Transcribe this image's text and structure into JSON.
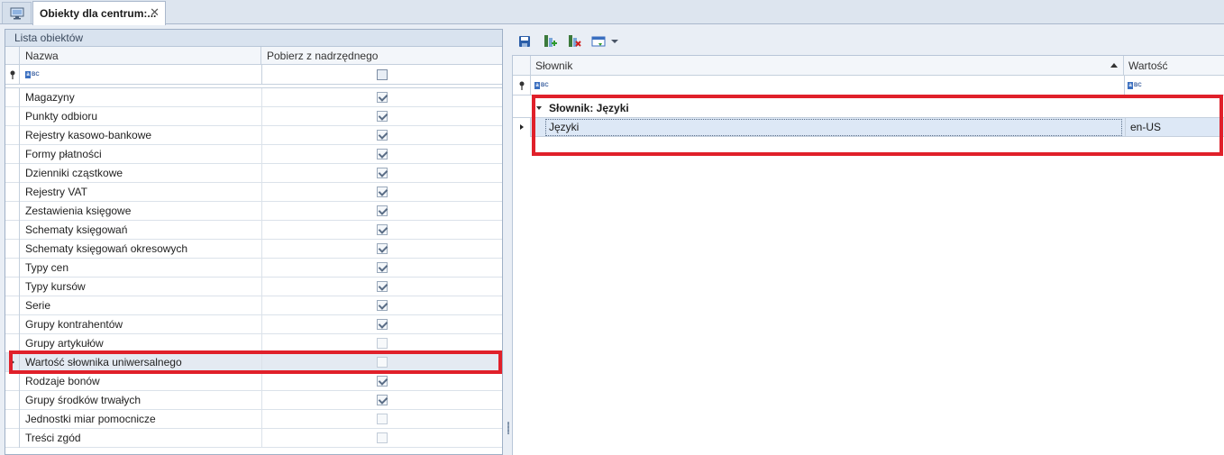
{
  "tabs": {
    "home_icon": "monitor-icon",
    "active_label": "Obiekty dla centrum:...",
    "close_glyph": "✕"
  },
  "left": {
    "panel_title": "Lista obiektów",
    "columns": {
      "name": "Nazwa",
      "inherit": "Pobierz z nadrzędnego"
    },
    "rows": [
      {
        "label": "Magazyny",
        "checked": true
      },
      {
        "label": "Punkty odbioru",
        "checked": true
      },
      {
        "label": "Rejestry kasowo-bankowe",
        "checked": true
      },
      {
        "label": "Formy płatności",
        "checked": true
      },
      {
        "label": "Dzienniki cząstkowe",
        "checked": true
      },
      {
        "label": "Rejestry VAT",
        "checked": true
      },
      {
        "label": "Zestawienia księgowe",
        "checked": true
      },
      {
        "label": "Schematy księgowań",
        "checked": true
      },
      {
        "label": "Schematy księgowań okresowych",
        "checked": true
      },
      {
        "label": "Typy cen",
        "checked": true
      },
      {
        "label": "Typy kursów",
        "checked": true
      },
      {
        "label": "Serie",
        "checked": true
      },
      {
        "label": "Grupy kontrahentów",
        "checked": true
      },
      {
        "label": "Grupy artykułów",
        "checked": false
      },
      {
        "label": "Wartość słownika uniwersalnego",
        "checked": false,
        "selected": true
      },
      {
        "label": "Rodzaje bonów",
        "checked": true
      },
      {
        "label": "Grupy środków trwałych",
        "checked": true
      },
      {
        "label": "Jednostki miar pomocnicze",
        "checked": false
      },
      {
        "label": "Treści zgód",
        "checked": false
      }
    ]
  },
  "right": {
    "toolbar_icons": [
      "save-icon",
      "add-icon",
      "delete-icon",
      "view-icon",
      "dropdown-arrow-icon"
    ],
    "columns": {
      "dictionary": "Słownik",
      "value": "Wartość"
    },
    "group_label": "Słownik: Języki",
    "row": {
      "name": "Języki",
      "value": "en-US"
    }
  },
  "colors": {
    "highlight": "#e0202a",
    "accent": "#3a6fc0"
  }
}
